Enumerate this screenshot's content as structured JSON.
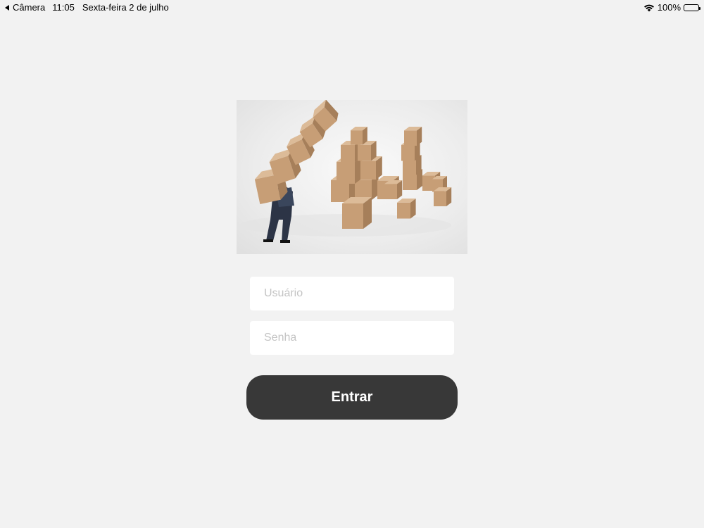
{
  "status_bar": {
    "back_label": "Câmera",
    "time": "11:05",
    "date": "Sexta-feira 2 de julho",
    "battery_percent": "100%",
    "wifi_icon": "wifi-icon",
    "battery_icon": "battery-icon"
  },
  "hero": {
    "image": "man-carrying-boxes-illustration"
  },
  "login": {
    "username_placeholder": "Usuário",
    "username_value": "",
    "password_placeholder": "Senha",
    "password_value": "",
    "submit_label": "Entrar"
  },
  "colors": {
    "background": "#f2f2f2",
    "button": "#383838",
    "button_text": "#ffffff",
    "input_bg": "#ffffff",
    "placeholder": "#c4c4c4",
    "box": "#c9a27c"
  }
}
